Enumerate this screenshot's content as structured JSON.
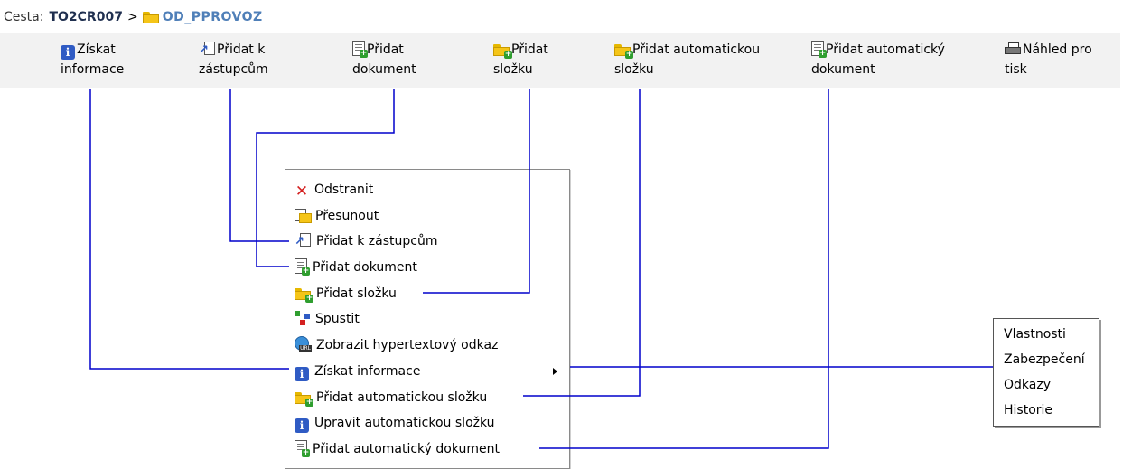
{
  "breadcrumb": {
    "label": "Cesta:",
    "node": "TO2CR007",
    "separator": ">",
    "current": "OD_PPROVOZ"
  },
  "toolbar": {
    "items": [
      {
        "line1": "Získat",
        "line2": "informace",
        "icon": "info-icon"
      },
      {
        "line1": "Přidat k",
        "line2": "zástupcům",
        "icon": "add-shortcut-icon"
      },
      {
        "line1": "Přidat",
        "line2": "dokument",
        "icon": "add-document-icon"
      },
      {
        "line1": "Přidat",
        "line2": "složku",
        "icon": "add-folder-icon"
      },
      {
        "line1": "Přidat automatickou",
        "line2": "složku",
        "icon": "add-auto-folder-icon"
      },
      {
        "line1": "Přidat automatický",
        "line2": "dokument",
        "icon": "add-auto-document-icon"
      },
      {
        "line1": "Náhled pro",
        "line2": "tisk",
        "icon": "printer-icon"
      }
    ]
  },
  "context_menu": {
    "items": [
      {
        "label": "Odstranit",
        "icon": "delete-icon"
      },
      {
        "label": "Přesunout",
        "icon": "move-icon"
      },
      {
        "label": "Přidat k zástupcům",
        "icon": "add-shortcut-icon"
      },
      {
        "label": "Přidat dokument",
        "icon": "add-document-icon"
      },
      {
        "label": "Přidat složku",
        "icon": "add-folder-icon"
      },
      {
        "label": "Spustit",
        "icon": "run-workflow-icon"
      },
      {
        "label": "Zobrazit hypertextový odkaz",
        "icon": "url-globe-icon"
      },
      {
        "label": "Získat informace",
        "icon": "info-icon"
      },
      {
        "label": "Přidat automatickou složku",
        "icon": "add-auto-folder-icon"
      },
      {
        "label": "Upravit automatickou složku",
        "icon": "info-icon"
      },
      {
        "label": "Přidat automatický dokument",
        "icon": "add-auto-document-icon"
      }
    ]
  },
  "submenu": {
    "items": [
      "Vlastnosti",
      "Zabezpečení",
      "Odkazy",
      "Historie"
    ]
  },
  "colors": {
    "connector_line": "#0000cc",
    "toolbar_bg": "#f2f2f2",
    "breadcrumb_current": "#4f7fb8"
  }
}
